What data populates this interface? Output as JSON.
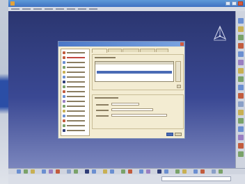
{
  "window": {
    "title": "",
    "accent": "#3f72c2"
  },
  "viewport": {
    "background_top": "#2b3670",
    "background_bottom": "#7b86bd"
  },
  "dialog": {
    "title": "",
    "tree_item_count": 17,
    "selected_tree_index": 1,
    "list_rows": 8,
    "selected_list_row": 2
  },
  "status": {
    "message": ""
  },
  "icons": [
    "compass-icon",
    "app-logo-icon",
    "toolbar-icon",
    "tree-node-icon"
  ]
}
